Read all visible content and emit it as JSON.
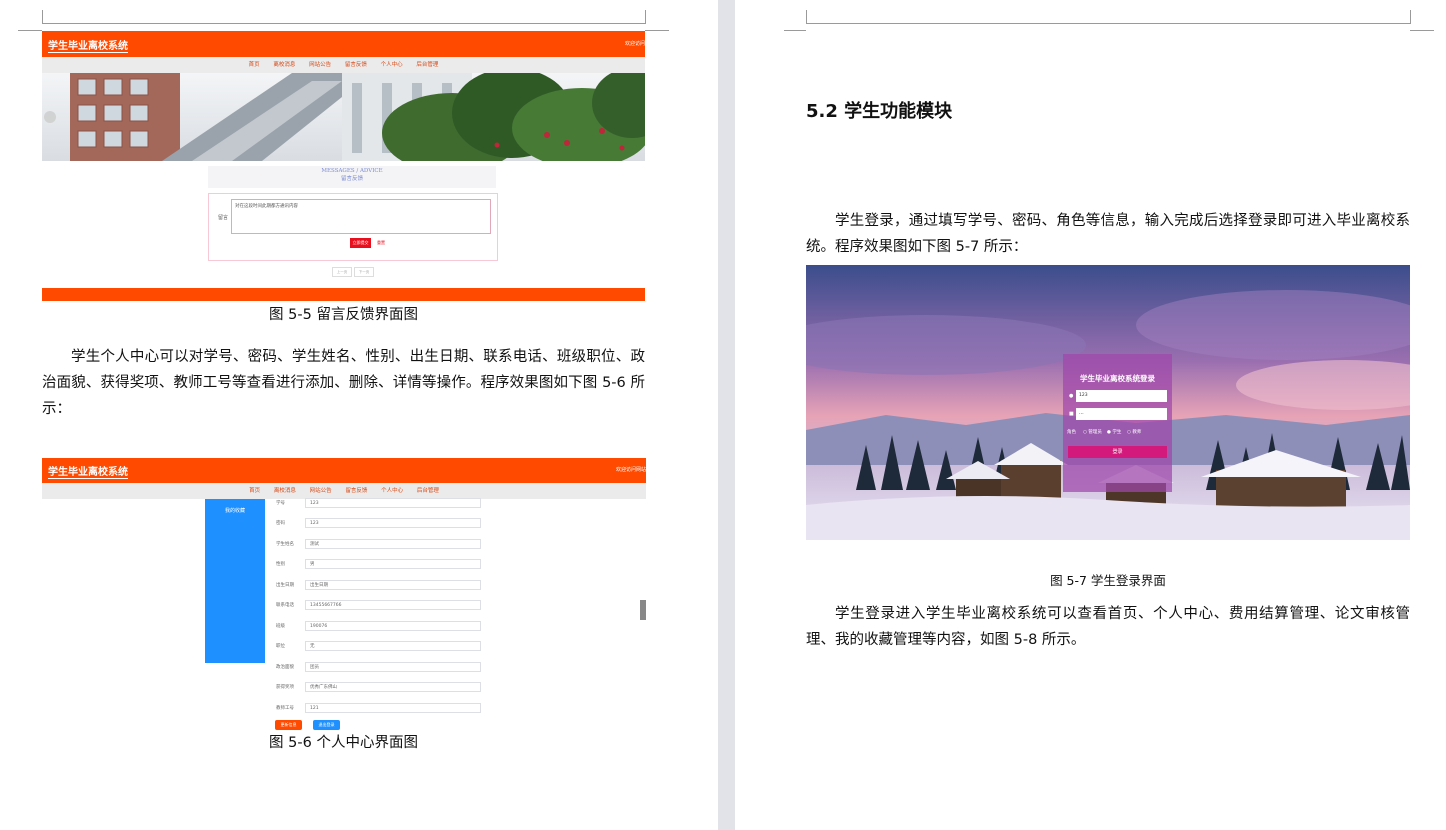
{
  "left": {
    "fig5": {
      "header_title": "学生毕业离校系统",
      "header_right": "欢迎访问",
      "nav": [
        "首页",
        "离校消息",
        "网站公告",
        "留言反馈",
        "个人中心",
        "后台管理"
      ],
      "msg_en": "MESSAGES / ADVICE",
      "msg_cn": "留言反馈",
      "field_label": "留言",
      "textarea_text": "对在这段时间此期都方通讯内容",
      "submit": "立即提交",
      "reset": "重置",
      "prev": "上一页",
      "next": "下一页",
      "caption": "图 5-5 留言反馈界面图"
    },
    "para1": "学生个人中心可以对学号、密码、学生姓名、性别、出生日期、联系电话、班级职位、政治面貌、获得奖项、教师工号等查看进行添加、删除、详情等操作。程序效果图如下图 5-6 所示：",
    "fig6": {
      "header_title": "学生毕业离校系统",
      "header_right": "欢迎访问网站",
      "nav": [
        "首页",
        "离校消息",
        "网站公告",
        "留言反馈",
        "个人中心",
        "后台管理"
      ],
      "sidebar_item": "我的收藏",
      "fields": [
        {
          "label": "学号",
          "value": "123"
        },
        {
          "label": "密码",
          "value": "123"
        },
        {
          "label": "学生姓名",
          "value": "测试"
        },
        {
          "label": "性别",
          "value": "男"
        },
        {
          "label": "出生日期",
          "value": "出生日期"
        },
        {
          "label": "联系电话",
          "value": "13455667766"
        },
        {
          "label": "班级",
          "value": "190076"
        },
        {
          "label": "职位",
          "value": "无"
        },
        {
          "label": "政治面貌",
          "value": "团员"
        },
        {
          "label": "获得奖项",
          "value": "优秀广东佛山"
        },
        {
          "label": "教师工号",
          "value": "121"
        }
      ],
      "btn_update": "更新信息",
      "btn_logout": "退出登录",
      "caption": "图 5-6 个人中心界面图"
    }
  },
  "right": {
    "heading": "5.2 学生功能模块",
    "para1": "学生登录，通过填写学号、密码、角色等信息，输入完成后选择登录即可进入毕业离校系统。程序效果图如下图 5-7 所示：",
    "fig7": {
      "login_title": "学生毕业离校系统登录",
      "user_value": "123",
      "pass_value": "···",
      "role_label": "角色",
      "roles": [
        "管理员",
        "学生",
        "教师"
      ],
      "login_btn": "登录",
      "caption": "图 5-7 学生登录界面"
    },
    "para2": "学生登录进入学生毕业离校系统可以查看首页、个人中心、费用结算管理、论文审核管理、我的收藏管理等内容，如图 5-8 所示。"
  }
}
